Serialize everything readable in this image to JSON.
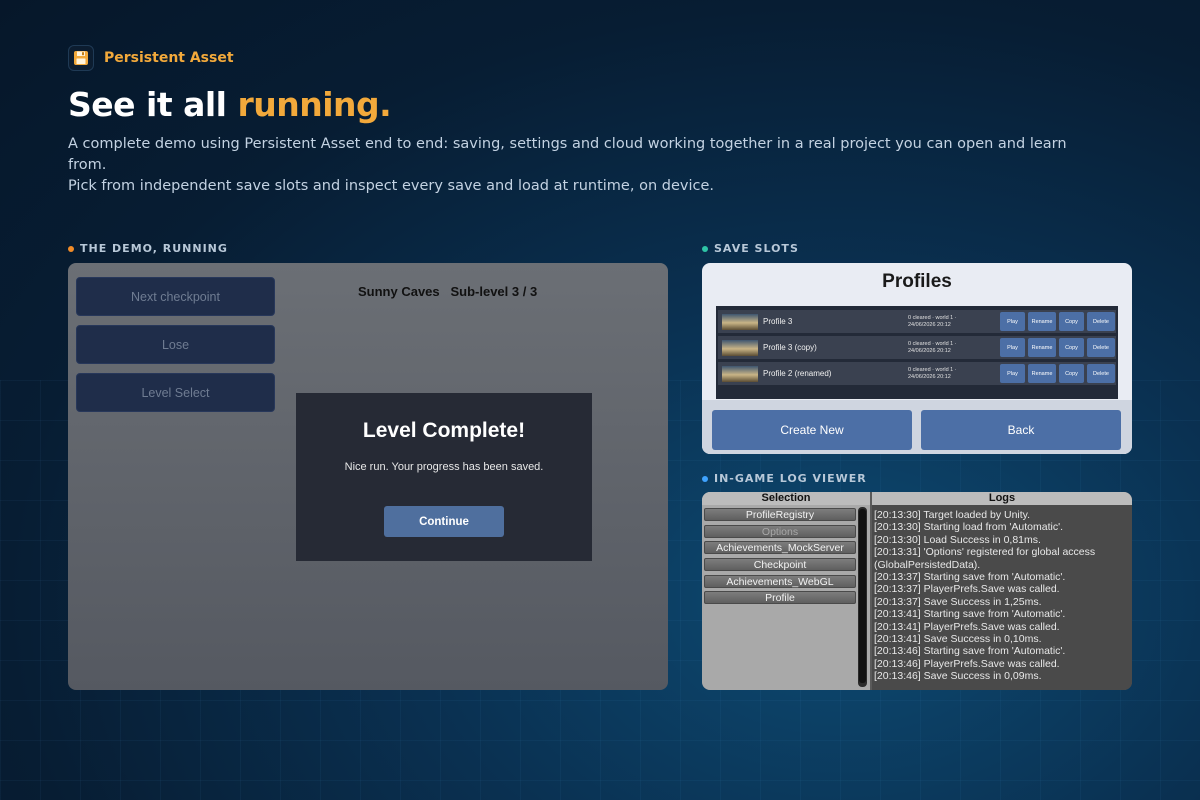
{
  "brand": {
    "name": "Persistent Asset",
    "icon": "floppy-disk-icon"
  },
  "headline": {
    "main": "See it all ",
    "accent": "running."
  },
  "subtitle": {
    "line1": "A complete demo using Persistent Asset end to end: saving, settings and cloud working together in a real project you can open and learn from.",
    "line2": "Pick from independent save slots and inspect every save and load at runtime, on device."
  },
  "sections": {
    "demo": "THE DEMO, RUNNING",
    "slots": "SAVE SLOTS",
    "logs": "IN-GAME LOG VIEWER"
  },
  "colors": {
    "accent": "#f2a93b",
    "dot_demo": "#f28c28",
    "dot_slots": "#2ec4a6",
    "dot_logs": "#3fa3ff"
  },
  "demo": {
    "buttons": [
      "Next checkpoint",
      "Lose",
      "Level Select"
    ],
    "level_title": "Sunny Caves   Sub-level 3 / 3",
    "modal": {
      "title": "Level Complete!",
      "text": "Nice run. Your progress has been saved.",
      "button": "Continue"
    }
  },
  "slots": {
    "title": "Profiles",
    "rows": [
      {
        "name": "Profile 3",
        "meta1": "0 cleared  ·  world 1  ·",
        "meta2": "24/06/2026 20:12"
      },
      {
        "name": "Profile 3 (copy)",
        "meta1": "0 cleared  ·  world 1  ·",
        "meta2": "24/06/2026 20:12"
      },
      {
        "name": "Profile 2 (renamed)",
        "meta1": "0 cleared  ·  world 1  ·",
        "meta2": "24/06/2026 20:12"
      }
    ],
    "row_buttons": [
      "Play",
      "Rename",
      "Copy",
      "Delete"
    ],
    "create_label": "Create New",
    "back_label": "Back"
  },
  "logs": {
    "selection_header": "Selection",
    "logs_header": "Logs",
    "selection_items": [
      "ProfileRegistry",
      "Options",
      "Achievements_MockServer",
      "Checkpoint",
      "Achievements_WebGL",
      "Profile"
    ],
    "lines": [
      "[20:13:30] Target loaded by Unity.",
      "[20:13:30] Starting load from 'Automatic'.",
      "[20:13:30] Load Success in 0,81ms.",
      "[20:13:31] 'Options' registered for global access",
      "(GlobalPersistedData).",
      "[20:13:37] Starting save from 'Automatic'.",
      "[20:13:37] PlayerPrefs.Save was called.",
      "[20:13:37] Save Success in 1,25ms.",
      "[20:13:41] Starting save from 'Automatic'.",
      "[20:13:41] PlayerPrefs.Save was called.",
      "[20:13:41] Save Success in 0,10ms.",
      "[20:13:46] Starting save from 'Automatic'.",
      "[20:13:46] PlayerPrefs.Save was called.",
      "[20:13:46] Save Success in 0,09ms."
    ]
  }
}
